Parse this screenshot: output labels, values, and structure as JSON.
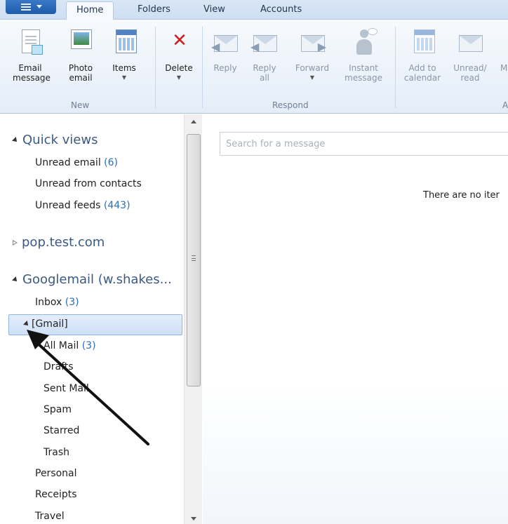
{
  "tabs": {
    "home": "Home",
    "folders": "Folders",
    "view": "View",
    "accounts": "Accounts"
  },
  "ribbon": {
    "email_message": "Email\nmessage",
    "photo_email": "Photo\nemail",
    "items": "Items",
    "delete": "Delete",
    "reply": "Reply",
    "reply_all": "Reply\nall",
    "forward": "Forward",
    "instant_message": "Instant\nmessage",
    "add_to_calendar": "Add to\ncalendar",
    "unread_read": "Unread/\nread",
    "move_partial": "M",
    "group_new": "New",
    "group_respond": "Respond",
    "group_partial": "A"
  },
  "sidebar": {
    "quick_views": "Quick views",
    "unread_email": "Unread email",
    "unread_email_count": "(6)",
    "unread_from_contacts": "Unread from contacts",
    "unread_feeds": "Unread feeds",
    "unread_feeds_count": "(443)",
    "pop_account": "pop.test.com",
    "google_account": "Googlemail (w.shakes...",
    "inbox": "Inbox",
    "inbox_count": "(3)",
    "gmail_folder": "[Gmail]",
    "all_mail": "All Mail",
    "all_mail_count": "(3)",
    "drafts": "Drafts",
    "sent_mail": "Sent Mail",
    "spam": "Spam",
    "starred": "Starred",
    "trash": "Trash",
    "personal": "Personal",
    "receipts": "Receipts",
    "travel": "Travel"
  },
  "message_pane": {
    "search_placeholder": "Search for a message",
    "empty_text": "There are no iter"
  },
  "icons": [
    "app-menu-icon",
    "email-message-icon",
    "photo-email-icon",
    "items-icon",
    "delete-icon",
    "reply-icon",
    "reply-all-icon",
    "forward-icon",
    "instant-message-icon",
    "add-to-calendar-icon",
    "unread-read-icon"
  ],
  "colors": {
    "accent_blue": "#2a6dbd",
    "delete_red": "#cc2020",
    "selection_fill": "#cfe0f6",
    "ribbon_bg": "#e4edf8"
  }
}
